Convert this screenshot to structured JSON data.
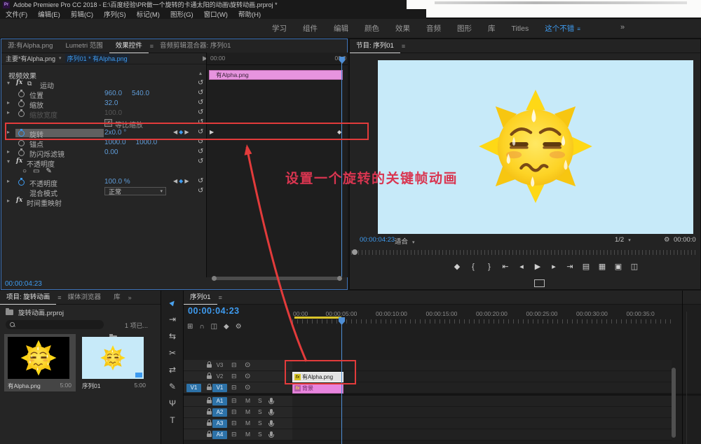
{
  "titlebar": {
    "app_icon": "Pr",
    "title": "Adobe Premiere Pro CC 2018 - E:\\百度经验\\PR做一个旋转的卡通太阳的动画\\旋转动画.prproj *"
  },
  "menubar": {
    "items": [
      "文件(F)",
      "编辑(E)",
      "剪辑(C)",
      "序列(S)",
      "标记(M)",
      "图形(G)",
      "窗口(W)",
      "帮助(H)"
    ]
  },
  "workspace": {
    "tabs": [
      "学习",
      "组件",
      "编辑",
      "颜色",
      "效果",
      "音频",
      "图形",
      "库",
      "Titles",
      "这个不错"
    ],
    "active": "这个不错",
    "overflow": "»"
  },
  "effects_panel": {
    "tabs": [
      {
        "label": "源:有Alpha.png",
        "active": false
      },
      {
        "label": "Lumetri 范围",
        "active": false
      },
      {
        "label": "效果控件",
        "active": true
      },
      {
        "label": "音频剪辑混合器: 序列01",
        "active": false
      }
    ],
    "clip_selector": {
      "master": "主要*有Alpha.png",
      "sequence": "序列01 * 有Alpha.png"
    },
    "rows": [
      {
        "kind": "section",
        "label": "视频效果"
      },
      {
        "kind": "group",
        "twirl": "open",
        "fx": true,
        "motion_icon": true,
        "label": "运动",
        "reset": true
      },
      {
        "kind": "param",
        "sw": true,
        "label": "位置",
        "values": [
          "960.0",
          "540.0"
        ],
        "reset": true
      },
      {
        "kind": "param",
        "twirl": "closed",
        "sw": true,
        "label": "缩放",
        "values": [
          "32.0"
        ],
        "reset": true
      },
      {
        "kind": "param",
        "twirl": "closed",
        "sw": true,
        "label": "缩放宽度",
        "values": [
          "100.0"
        ],
        "disabled": true,
        "reset": true
      },
      {
        "kind": "check",
        "label": "等比缩放",
        "checked": true,
        "reset": true
      },
      {
        "kind": "param",
        "twirl": "closed",
        "sw": "active",
        "label": "旋转",
        "values": [
          "2x0.0 °"
        ],
        "nav": true,
        "reset": true,
        "highlight": true
      },
      {
        "kind": "param",
        "sw": true,
        "label": "锚点",
        "values": [
          "1000.0",
          "1000.0"
        ],
        "reset": true
      },
      {
        "kind": "param",
        "twirl": "closed",
        "sw": true,
        "label": "防闪烁滤镜",
        "values": [
          "0.00"
        ],
        "reset": true
      },
      {
        "kind": "group",
        "twirl": "open",
        "fx": true,
        "label": "不透明度",
        "reset": true
      },
      {
        "kind": "masks",
        "icons": [
          "ellipse-mask-icon",
          "rect-mask-icon",
          "pen-mask-icon"
        ]
      },
      {
        "kind": "param",
        "twirl": "closed",
        "sw": "active",
        "label": "不透明度",
        "values": [
          "100.0 %"
        ],
        "nav": true,
        "reset": true
      },
      {
        "kind": "dropdown",
        "label": "混合模式",
        "value": "正常",
        "reset": true
      },
      {
        "kind": "group",
        "twirl": "closed",
        "fx": true,
        "label": "时间重映射"
      }
    ],
    "mini_timeline": {
      "ruler_left": "00:00",
      "ruler_right": "00:0",
      "clip": "有Alpha.png"
    },
    "timecode": "00:00:04:23"
  },
  "program": {
    "tab": "节目: 序列01",
    "timecode": "00:00:04:23",
    "fit": "适合",
    "zoom": "1/2",
    "right_timecode": "00:00:0",
    "transport": [
      "add-marker-icon",
      "mark-in-icon",
      "mark-out-icon",
      "go-to-in-icon",
      "step-back-icon",
      "play-icon",
      "step-forward-icon",
      "go-to-out-icon",
      "lift-icon",
      "extract-icon",
      "export-frame-icon",
      "comparison-view-icon"
    ]
  },
  "annotation": {
    "text": "设置一个旋转的关键帧动画",
    "color": "#d93550",
    "shape_color": "#e23b3b"
  },
  "project": {
    "tabs": [
      {
        "label": "项目: 旋转动画",
        "active": true
      },
      {
        "label": "媒体浏览器",
        "active": false
      },
      {
        "label": "库",
        "active": false
      }
    ],
    "overflow": "»",
    "file": "旋转动画.prproj",
    "count_label": "1 项已...",
    "items": [
      {
        "name": "有Alpha.png",
        "duration": "5:00",
        "selected": true,
        "thumb_bg": "#000000"
      },
      {
        "name": "序列01",
        "duration": "5:00",
        "selected": false,
        "thumb_bg": "#c7eaf9"
      }
    ]
  },
  "tools": [
    "selection-tool",
    "track-select-forward-tool",
    "ripple-edit-tool",
    "razor-tool",
    "slip-tool",
    "pen-tool",
    "hand-tool",
    "type-tool"
  ],
  "timeline": {
    "tab": "序列01",
    "timecode": "00:00:04:23",
    "toolbar_icons": [
      "insert-nest-icon",
      "snap-icon",
      "linked-selection-icon",
      "add-marker-icon",
      "timeline-settings-icon"
    ],
    "ruler_labels": [
      "00:00",
      "00:00:05:00",
      "00:00:10:00",
      "00:00:15:00",
      "00:00:20:00",
      "00:00:25:00",
      "00:00:30:00",
      "00:00:35:0"
    ],
    "video_tracks": [
      {
        "name": "V3",
        "source": "",
        "blue": false
      },
      {
        "name": "V2",
        "source": "",
        "blue": false
      },
      {
        "name": "V1",
        "source": "V1",
        "blue": true
      }
    ],
    "audio_tracks": [
      {
        "name": "A1",
        "blue": true
      },
      {
        "name": "A2",
        "blue": true
      },
      {
        "name": "A3",
        "blue": true
      },
      {
        "name": "A4",
        "blue": true
      }
    ],
    "clips": [
      {
        "name": "有Alpha.png",
        "fx": "fx",
        "style": "white"
      },
      {
        "name": "背景",
        "fx": "fx",
        "style": "pink"
      }
    ],
    "colors": {
      "playhead": "#4f8fd6",
      "workbar": "#d9c32a"
    }
  }
}
